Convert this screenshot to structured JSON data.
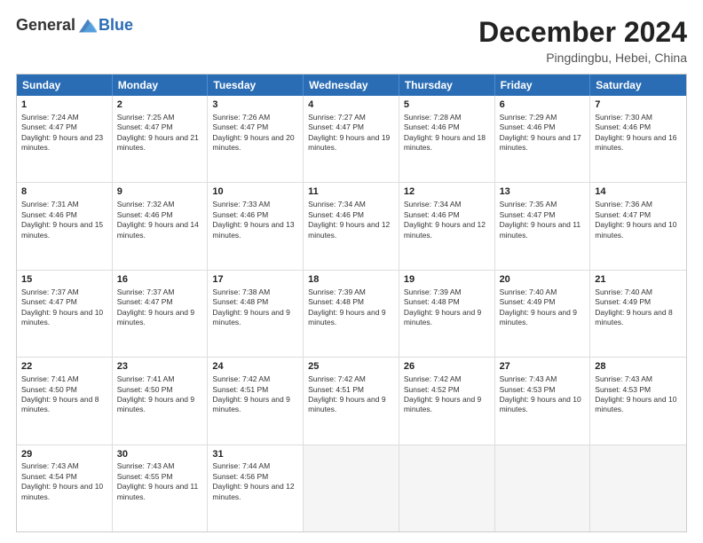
{
  "header": {
    "logo_general": "General",
    "logo_blue": "Blue",
    "month_title": "December 2024",
    "location": "Pingdingbu, Hebei, China"
  },
  "days_of_week": [
    "Sunday",
    "Monday",
    "Tuesday",
    "Wednesday",
    "Thursday",
    "Friday",
    "Saturday"
  ],
  "weeks": [
    [
      {
        "day": "1",
        "sunrise": "Sunrise: 7:24 AM",
        "sunset": "Sunset: 4:47 PM",
        "daylight": "Daylight: 9 hours and 23 minutes."
      },
      {
        "day": "2",
        "sunrise": "Sunrise: 7:25 AM",
        "sunset": "Sunset: 4:47 PM",
        "daylight": "Daylight: 9 hours and 21 minutes."
      },
      {
        "day": "3",
        "sunrise": "Sunrise: 7:26 AM",
        "sunset": "Sunset: 4:47 PM",
        "daylight": "Daylight: 9 hours and 20 minutes."
      },
      {
        "day": "4",
        "sunrise": "Sunrise: 7:27 AM",
        "sunset": "Sunset: 4:47 PM",
        "daylight": "Daylight: 9 hours and 19 minutes."
      },
      {
        "day": "5",
        "sunrise": "Sunrise: 7:28 AM",
        "sunset": "Sunset: 4:46 PM",
        "daylight": "Daylight: 9 hours and 18 minutes."
      },
      {
        "day": "6",
        "sunrise": "Sunrise: 7:29 AM",
        "sunset": "Sunset: 4:46 PM",
        "daylight": "Daylight: 9 hours and 17 minutes."
      },
      {
        "day": "7",
        "sunrise": "Sunrise: 7:30 AM",
        "sunset": "Sunset: 4:46 PM",
        "daylight": "Daylight: 9 hours and 16 minutes."
      }
    ],
    [
      {
        "day": "8",
        "sunrise": "Sunrise: 7:31 AM",
        "sunset": "Sunset: 4:46 PM",
        "daylight": "Daylight: 9 hours and 15 minutes."
      },
      {
        "day": "9",
        "sunrise": "Sunrise: 7:32 AM",
        "sunset": "Sunset: 4:46 PM",
        "daylight": "Daylight: 9 hours and 14 minutes."
      },
      {
        "day": "10",
        "sunrise": "Sunrise: 7:33 AM",
        "sunset": "Sunset: 4:46 PM",
        "daylight": "Daylight: 9 hours and 13 minutes."
      },
      {
        "day": "11",
        "sunrise": "Sunrise: 7:34 AM",
        "sunset": "Sunset: 4:46 PM",
        "daylight": "Daylight: 9 hours and 12 minutes."
      },
      {
        "day": "12",
        "sunrise": "Sunrise: 7:34 AM",
        "sunset": "Sunset: 4:46 PM",
        "daylight": "Daylight: 9 hours and 12 minutes."
      },
      {
        "day": "13",
        "sunrise": "Sunrise: 7:35 AM",
        "sunset": "Sunset: 4:47 PM",
        "daylight": "Daylight: 9 hours and 11 minutes."
      },
      {
        "day": "14",
        "sunrise": "Sunrise: 7:36 AM",
        "sunset": "Sunset: 4:47 PM",
        "daylight": "Daylight: 9 hours and 10 minutes."
      }
    ],
    [
      {
        "day": "15",
        "sunrise": "Sunrise: 7:37 AM",
        "sunset": "Sunset: 4:47 PM",
        "daylight": "Daylight: 9 hours and 10 minutes."
      },
      {
        "day": "16",
        "sunrise": "Sunrise: 7:37 AM",
        "sunset": "Sunset: 4:47 PM",
        "daylight": "Daylight: 9 hours and 9 minutes."
      },
      {
        "day": "17",
        "sunrise": "Sunrise: 7:38 AM",
        "sunset": "Sunset: 4:48 PM",
        "daylight": "Daylight: 9 hours and 9 minutes."
      },
      {
        "day": "18",
        "sunrise": "Sunrise: 7:39 AM",
        "sunset": "Sunset: 4:48 PM",
        "daylight": "Daylight: 9 hours and 9 minutes."
      },
      {
        "day": "19",
        "sunrise": "Sunrise: 7:39 AM",
        "sunset": "Sunset: 4:48 PM",
        "daylight": "Daylight: 9 hours and 9 minutes."
      },
      {
        "day": "20",
        "sunrise": "Sunrise: 7:40 AM",
        "sunset": "Sunset: 4:49 PM",
        "daylight": "Daylight: 9 hours and 9 minutes."
      },
      {
        "day": "21",
        "sunrise": "Sunrise: 7:40 AM",
        "sunset": "Sunset: 4:49 PM",
        "daylight": "Daylight: 9 hours and 8 minutes."
      }
    ],
    [
      {
        "day": "22",
        "sunrise": "Sunrise: 7:41 AM",
        "sunset": "Sunset: 4:50 PM",
        "daylight": "Daylight: 9 hours and 8 minutes."
      },
      {
        "day": "23",
        "sunrise": "Sunrise: 7:41 AM",
        "sunset": "Sunset: 4:50 PM",
        "daylight": "Daylight: 9 hours and 9 minutes."
      },
      {
        "day": "24",
        "sunrise": "Sunrise: 7:42 AM",
        "sunset": "Sunset: 4:51 PM",
        "daylight": "Daylight: 9 hours and 9 minutes."
      },
      {
        "day": "25",
        "sunrise": "Sunrise: 7:42 AM",
        "sunset": "Sunset: 4:51 PM",
        "daylight": "Daylight: 9 hours and 9 minutes."
      },
      {
        "day": "26",
        "sunrise": "Sunrise: 7:42 AM",
        "sunset": "Sunset: 4:52 PM",
        "daylight": "Daylight: 9 hours and 9 minutes."
      },
      {
        "day": "27",
        "sunrise": "Sunrise: 7:43 AM",
        "sunset": "Sunset: 4:53 PM",
        "daylight": "Daylight: 9 hours and 10 minutes."
      },
      {
        "day": "28",
        "sunrise": "Sunrise: 7:43 AM",
        "sunset": "Sunset: 4:53 PM",
        "daylight": "Daylight: 9 hours and 10 minutes."
      }
    ],
    [
      {
        "day": "29",
        "sunrise": "Sunrise: 7:43 AM",
        "sunset": "Sunset: 4:54 PM",
        "daylight": "Daylight: 9 hours and 10 minutes."
      },
      {
        "day": "30",
        "sunrise": "Sunrise: 7:43 AM",
        "sunset": "Sunset: 4:55 PM",
        "daylight": "Daylight: 9 hours and 11 minutes."
      },
      {
        "day": "31",
        "sunrise": "Sunrise: 7:44 AM",
        "sunset": "Sunset: 4:56 PM",
        "daylight": "Daylight: 9 hours and 12 minutes."
      },
      {
        "day": "",
        "sunrise": "",
        "sunset": "",
        "daylight": ""
      },
      {
        "day": "",
        "sunrise": "",
        "sunset": "",
        "daylight": ""
      },
      {
        "day": "",
        "sunrise": "",
        "sunset": "",
        "daylight": ""
      },
      {
        "day": "",
        "sunrise": "",
        "sunset": "",
        "daylight": ""
      }
    ]
  ]
}
